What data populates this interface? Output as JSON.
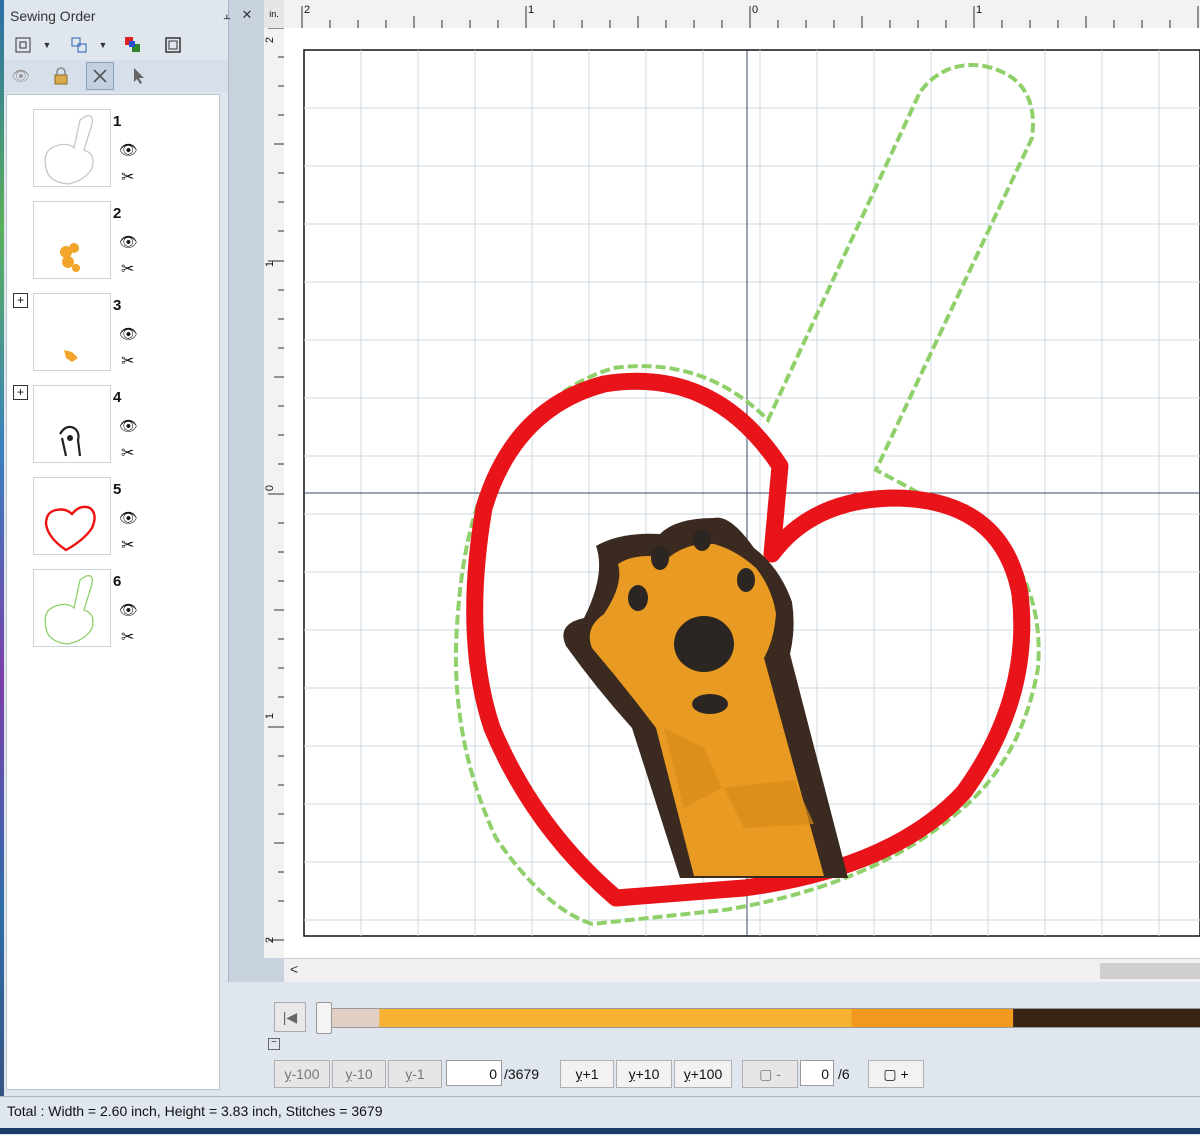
{
  "panel": {
    "title": "Sewing Order",
    "pin_icon": "pin-icon",
    "close_icon": "close-icon",
    "items": [
      {
        "number": "1",
        "expandable": false,
        "thumb": "heart-tag-outline-gray"
      },
      {
        "number": "2",
        "expandable": false,
        "thumb": "paw-orange-pads"
      },
      {
        "number": "3",
        "expandable": true,
        "thumb": "paw-orange-fill"
      },
      {
        "number": "4",
        "expandable": true,
        "thumb": "paw-dark-outline"
      },
      {
        "number": "5",
        "expandable": false,
        "thumb": "heart-red"
      },
      {
        "number": "6",
        "expandable": false,
        "thumb": "heart-tag-outline-green"
      }
    ]
  },
  "ruler": {
    "unit": "in.",
    "top_labels": [
      "2",
      "1",
      "0",
      "1"
    ],
    "left_labels": [
      "2",
      "1",
      "0",
      "1",
      "2"
    ]
  },
  "colors": {
    "outline_green": "#8fd06a",
    "heart_red": "#e8141a",
    "paw_orange": "#e89a22",
    "paw_dark": "#3a2a20",
    "paw_pad": "#2b2622",
    "grid": "#cfd8e0"
  },
  "timeline": {
    "segments": [
      {
        "color": "#e0cfc2",
        "fraction": 0.06
      },
      {
        "color": "#f7b234",
        "fraction": 0.54
      },
      {
        "color": "#f39a1e",
        "fraction": 0.185
      },
      {
        "color": "#3a2414",
        "fraction": 0.215
      }
    ]
  },
  "stitch_controls": {
    "back100": "-100",
    "back10": "-10",
    "back1": "-1",
    "current": "0",
    "total": "/3679",
    "fwd1": "+1",
    "fwd10": "+10",
    "fwd100": "+100",
    "color_minus": "-",
    "color_current": "0",
    "color_total": "/6",
    "color_plus": "+"
  },
  "status": {
    "text": "Total : Width = 2.60 inch, Height = 3.83 inch, Stitches = 3679"
  }
}
